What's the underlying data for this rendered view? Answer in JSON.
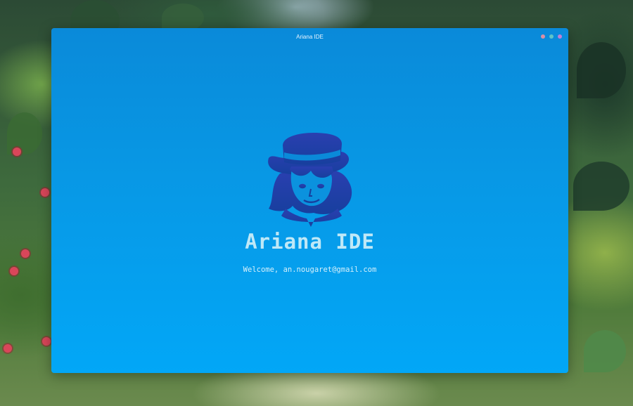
{
  "window": {
    "title": "Ariana IDE"
  },
  "window_controls": [
    {
      "name": "close-dot",
      "color": "#d98fa6"
    },
    {
      "name": "minimize-dot",
      "color": "#5fc3c9"
    },
    {
      "name": "maximize-dot",
      "color": "#c07fd6"
    }
  ],
  "hero": {
    "logo_icon": "ariana-mascot-icon",
    "app_name": "Ariana IDE",
    "welcome_text": "Welcome, an.nougaret@gmail.com"
  },
  "colors": {
    "window_top": "#0a8ad9",
    "window_bottom": "#02a7f7",
    "logo": "#1f3fa6",
    "app_name": "#bfe8f7"
  }
}
